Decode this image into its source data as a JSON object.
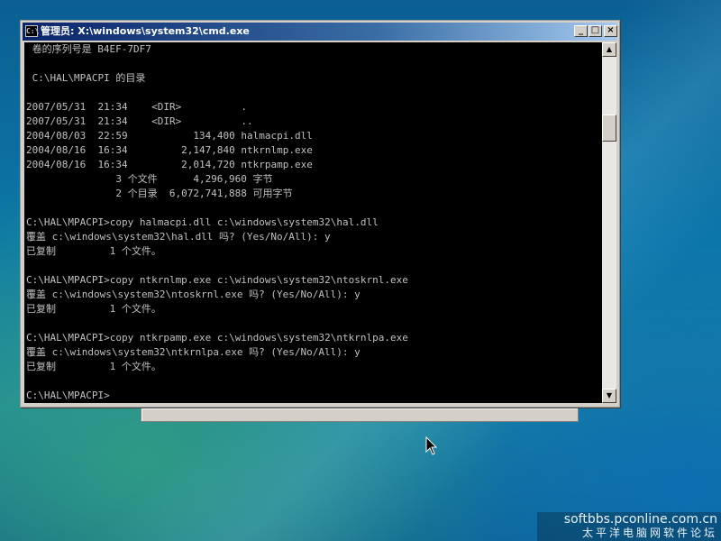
{
  "window": {
    "title": "管理员: X:\\windows\\system32\\cmd.exe",
    "icon_text": "C:\\",
    "minimize": "_",
    "maximize": "□",
    "close": "×"
  },
  "console": {
    "lines": [
      " 卷的序列号是 B4EF-7DF7",
      "",
      " C:\\HAL\\MPACPI 的目录",
      "",
      "2007/05/31  21:34    <DIR>          .",
      "2007/05/31  21:34    <DIR>          ..",
      "2004/08/03  22:59           134,400 halmacpi.dll",
      "2004/08/16  16:34         2,147,840 ntkrnlmp.exe",
      "2004/08/16  16:34         2,014,720 ntkrpamp.exe",
      "               3 个文件      4,296,960 字节",
      "               2 个目录  6,072,741,888 可用字节",
      "",
      "C:\\HAL\\MPACPI>copy halmacpi.dll c:\\windows\\system32\\hal.dll",
      "覆盖 c:\\windows\\system32\\hal.dll 吗? (Yes/No/All): y",
      "已复制         1 个文件。",
      "",
      "C:\\HAL\\MPACPI>copy ntkrnlmp.exe c:\\windows\\system32\\ntoskrnl.exe",
      "覆盖 c:\\windows\\system32\\ntoskrnl.exe 吗? (Yes/No/All): y",
      "已复制         1 个文件。",
      "",
      "C:\\HAL\\MPACPI>copy ntkrpamp.exe c:\\windows\\system32\\ntkrnlpa.exe",
      "覆盖 c:\\windows\\system32\\ntkrnlpa.exe 吗? (Yes/No/All): y",
      "已复制         1 个文件。",
      "",
      "C:\\HAL\\MPACPI>"
    ]
  },
  "scrollbar": {
    "up": "▲",
    "down": "▼"
  },
  "watermark": {
    "line1": "softbbs.pconline.com.cn",
    "line2": "太平洋电脑网软件论坛"
  }
}
